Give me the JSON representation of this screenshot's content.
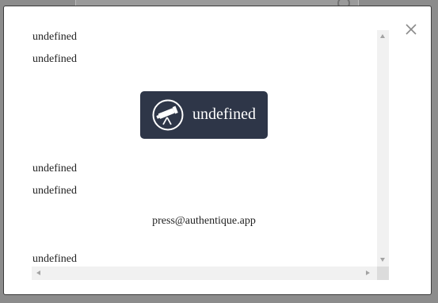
{
  "modal": {
    "close_icon": "close-icon",
    "lines": [
      "undefined",
      "undefined",
      "undefined",
      "undefined",
      "undefined"
    ],
    "brand": {
      "icon": "telescope-icon",
      "label": "undefined",
      "background_color": "#2e3648"
    },
    "email": "press@authentique.app"
  },
  "colors": {
    "backdrop": "#8c8c8c",
    "modal_background": "#ffffff",
    "scrollbar_track": "#f1f1f1"
  }
}
